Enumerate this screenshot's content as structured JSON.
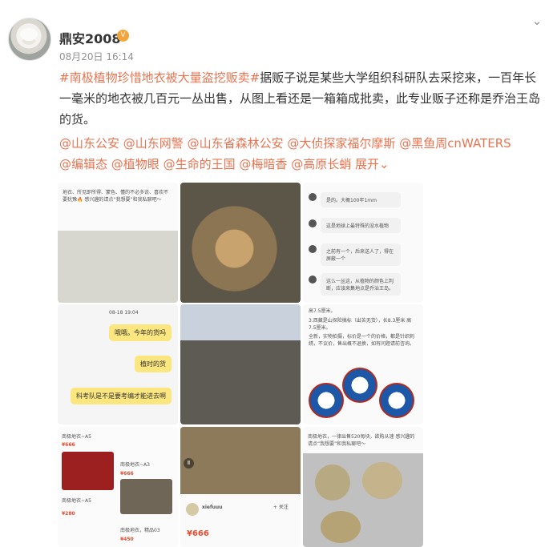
{
  "header": {
    "username": "鼎安2008",
    "timestamp": "08月20日 16:14"
  },
  "post": {
    "hashtag": "#南极植物珍惜地衣被大量盗挖贩卖#",
    "body": "据贩子说是某些大学组织科研队去采挖来，一百年长一毫米的地衣被几百元一丛出售，从图上看还是一箱箱成批卖，此专业贩子还称是乔治王岛的货。",
    "mentions": [
      "@山东公安",
      "@山东网警",
      "@山东省森林公安",
      "@大侦探家福尔摩斯",
      "@黑鱼周cnWATERS",
      "@编辑态",
      "@植物眼",
      "@生命的王国",
      "@梅暗香",
      "@高原长蛸"
    ],
    "expand_label": "展开"
  },
  "images": {
    "img1_caption": "地衣、所见即所得、蒙色、懂的不必多说、喜欢不要犹豫🔥 感兴趣的请点“我想要”和我私聊吧～",
    "img3_lines": [
      "是的。大概100年1mm",
      "这是地球上最特殊的没水植物",
      "之前有一个，后来送人了，得在屏蔽一个",
      "这么一丛这，从植物的颜色上判断，应该来集地点是乔治王岛。"
    ],
    "img4_time": "08-18 19:04",
    "img4_bubbles": [
      "哦哦。今年的货吗",
      "植时的货",
      "科考队是不是要考编才能进去啊"
    ],
    "img6_lines": [
      "高7.5厘米。",
      "3.西藏是山探险搞标（出苦无货），长8.3厘米 高7.5厘米。",
      "全新，实物拍摄，标价是一个的价格，都是针织刺绣，不议价，售出概不退换，如有问题请前咨询。"
    ],
    "img7_prices": [
      "南极地衣~A5",
      "¥666",
      "南极地衣~A3",
      "¥666",
      "南极地衣~A5",
      "¥280",
      "南极地衣，精品03",
      "¥450"
    ],
    "img8_user": "xiefuuu",
    "img8_follow": "+ 关注",
    "img8_price": "¥666",
    "img9_caption": "南极地衣，一律出售520每块，欲购从速 感兴趣的请点“我想要”和我私聊吧～"
  }
}
